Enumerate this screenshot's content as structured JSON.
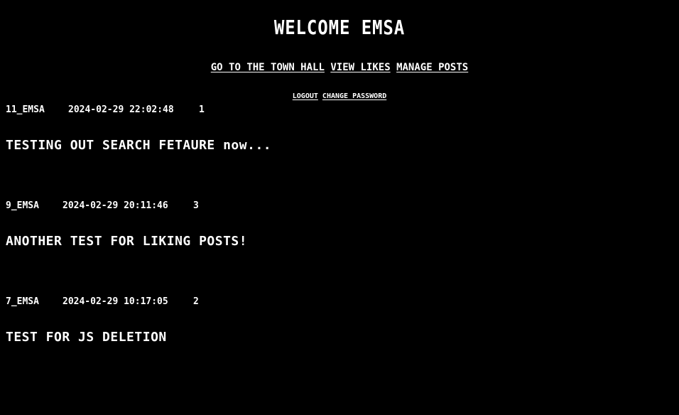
{
  "header": {
    "title": "WELCOME EMSA"
  },
  "nav": {
    "town_hall": "GO TO THE TOWN HALL",
    "view_likes": "VIEW LIKES",
    "manage_posts": "MANAGE POSTS",
    "logout": "LOGOUT",
    "change_password": "CHANGE PASSWORD"
  },
  "posts": [
    {
      "id": "11_EMSA",
      "timestamp": "2024-02-29 22:02:48",
      "likes": "1",
      "body": "TESTING OUT SEARCH FETAURE now..."
    },
    {
      "id": "9_EMSA",
      "timestamp": "2024-02-29 20:11:46",
      "likes": "3",
      "body": "ANOTHER TEST FOR LIKING POSTS!"
    },
    {
      "id": "7_EMSA",
      "timestamp": "2024-02-29 10:17:05",
      "likes": "2",
      "body": "TEST FOR JS DELETION"
    }
  ]
}
